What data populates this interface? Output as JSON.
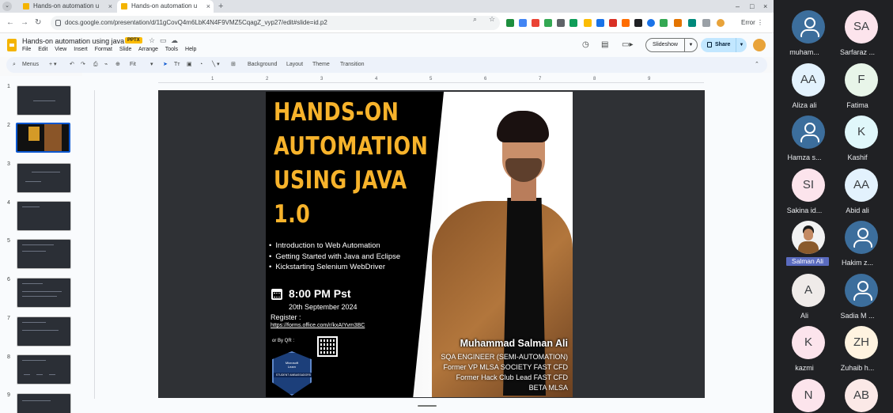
{
  "browser": {
    "tabs": [
      {
        "title": "Hands-on automation u"
      },
      {
        "title": "Hands-on automation u"
      }
    ],
    "url": "docs.google.com/presentation/d/11gCovQ4m6LbK4N4F9VMZ5CqagZ_vyp27/edit#slide=id.p2",
    "error_label": "Error"
  },
  "app": {
    "doc_title": "Hands-on automation using java",
    "file_badge": "PPTX",
    "menus": [
      "File",
      "Edit",
      "View",
      "Insert",
      "Format",
      "Slide",
      "Arrange",
      "Tools",
      "Help"
    ],
    "slideshow_label": "Slideshow",
    "share_label": "Share"
  },
  "format_bar": {
    "menus_label": "Menus",
    "zoom_label": "Fit",
    "background_label": "Background",
    "layout_label": "Layout",
    "theme_label": "Theme",
    "transition_label": "Transition"
  },
  "filmstrip": {
    "slide_numbers": [
      "1",
      "2",
      "3",
      "4",
      "5",
      "6",
      "7",
      "8",
      "9"
    ],
    "active_slide": 2
  },
  "ruler": [
    "1",
    "2",
    "3",
    "4",
    "5",
    "6",
    "7",
    "8",
    "9"
  ],
  "slide": {
    "title_lines": [
      "HANDS-ON",
      "AUTOMATION",
      "USING JAVA",
      "1.0"
    ],
    "bullets": [
      "Introduction to Web Automation",
      "Getting Started with Java and Eclipse",
      "Kickstarting Selenium WebDriver"
    ],
    "time": "8:00 PM Pst",
    "date": "20th September 2024",
    "register_label": "Register :",
    "register_link": "https://forms.office.com/r/kxAIYvm3BC",
    "qr_label": "or By QR :",
    "badge_lines": [
      "Microsoft",
      "Learn"
    ],
    "badge_band": "STUDENT AMBASSADORS",
    "speaker_name": "Muhammad Salman Ali",
    "speaker_lines": [
      "SQA ENGINEER (SEMI-AUTOMATION)",
      "Former VP MLSA SOCIETY FAST CFD",
      "Former Hack Club Lead FAST CFD",
      "BETA MLSA"
    ]
  },
  "participants": [
    {
      "initials": "",
      "name": "muham...",
      "avatar": "generic-person-icon",
      "bg": "#3c6e9c"
    },
    {
      "initials": "SA",
      "name": "Sarfaraz ...",
      "avatar": "initials",
      "bg": "#fce4ec"
    },
    {
      "initials": "AA",
      "name": "Aliza ali",
      "avatar": "initials",
      "bg": "#e3f2fd"
    },
    {
      "initials": "F",
      "name": "Fatima",
      "avatar": "initials",
      "bg": "#e8f5e9"
    },
    {
      "initials": "",
      "name": "Hamza s...",
      "avatar": "generic-person-icon",
      "bg": "#3c6e9c"
    },
    {
      "initials": "K",
      "name": "Kashif",
      "avatar": "initials",
      "bg": "#e0f7fa"
    },
    {
      "initials": "SI",
      "name": "Sakina id...",
      "avatar": "initials",
      "bg": "#fce4ec"
    },
    {
      "initials": "AA",
      "name": "Abid ali",
      "avatar": "initials",
      "bg": "#e3f2fd"
    },
    {
      "initials": "",
      "name": "Salman Ali",
      "avatar": "photo",
      "bg": "#f2f2f2",
      "highlight": true
    },
    {
      "initials": "",
      "name": "Hakim z...",
      "avatar": "generic-person-icon",
      "bg": "#3c6e9c"
    },
    {
      "initials": "A",
      "name": "Ali",
      "avatar": "initials",
      "bg": "#efebe9"
    },
    {
      "initials": "",
      "name": "Sadia M ...",
      "avatar": "generic-person-icon",
      "bg": "#3c6e9c"
    },
    {
      "initials": "K",
      "name": "kazmi",
      "avatar": "initials",
      "bg": "#fce4ec"
    },
    {
      "initials": "ZH",
      "name": "Zuhaib h...",
      "avatar": "initials",
      "bg": "#fff3e0"
    },
    {
      "initials": "N",
      "name": "",
      "avatar": "initials",
      "bg": "#fce4ec"
    },
    {
      "initials": "AB",
      "name": "",
      "avatar": "initials",
      "bg": "#fbe9e7"
    }
  ],
  "colors": {
    "poster_title": "#f7b32b",
    "share_button": "#c2e7ff",
    "active_thumb_border": "#0b57d0",
    "meet_bg": "#202124"
  }
}
